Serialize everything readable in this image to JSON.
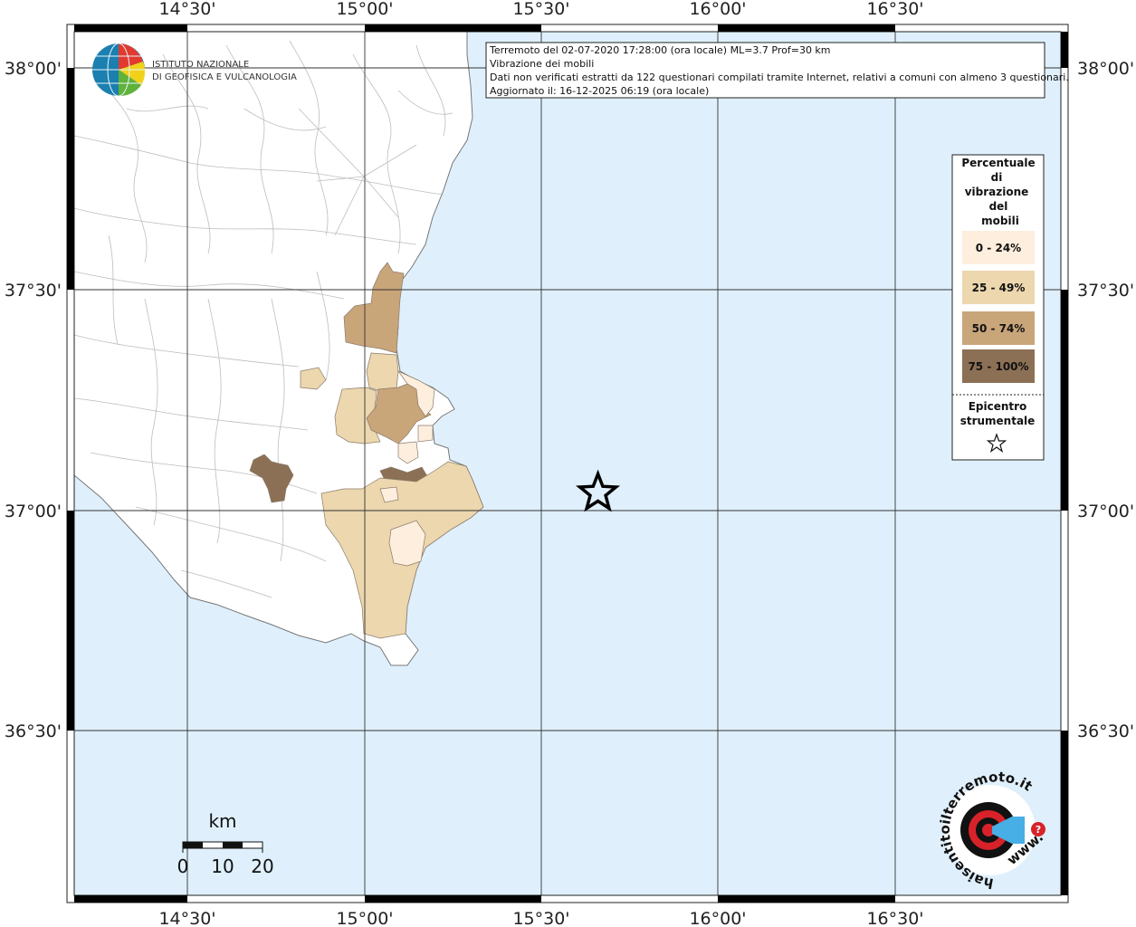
{
  "map": {
    "lon_labels": [
      "14°30'",
      "15°00'",
      "15°30'",
      "16°00'",
      "16°30'"
    ],
    "lat_labels": [
      "38°00'",
      "37°30'",
      "37°00'",
      "36°30'"
    ],
    "colors": {
      "sea": "#dff0fc",
      "land": "#ffffff",
      "class_0_24": "#fdeedd",
      "class_25_49": "#ecd7ae",
      "class_50_74": "#c9a57a",
      "class_75_100": "#8c7055"
    }
  },
  "info": {
    "line1": "Terremoto del 02-07-2020 17:28:00 (ora locale) ML=3.7 Prof=30 km",
    "line2": "Vibrazione dei mobili",
    "line3": "Dati non verificati estratti da 122 questionari compilati tramite Internet, relativi a comuni con almeno 3 questionari.",
    "line4": "Aggiornato il: 16-12-2025 06:19 (ora locale)"
  },
  "ingv": {
    "line1": "ISTITUTO NAZIONALE",
    "line2": "DI GEOFISICA E VULCANOLOGIA"
  },
  "legend": {
    "title_lines": [
      "Percentuale",
      "di",
      "vibrazione",
      "del",
      "mobili"
    ],
    "classes": [
      "0 - 24%",
      "25 - 49%",
      "50 - 74%",
      "75 - 100%"
    ],
    "epicentro_lines": [
      "Epicentro",
      "strumentale"
    ]
  },
  "scalebar": {
    "unit": "km",
    "labels": [
      "0",
      "10",
      "20"
    ]
  },
  "hai_sentito": {
    "text": "haisentitoilterremoto.it",
    "www": "www."
  },
  "epicenter": {
    "lon": 15.66,
    "lat": 37.04
  }
}
